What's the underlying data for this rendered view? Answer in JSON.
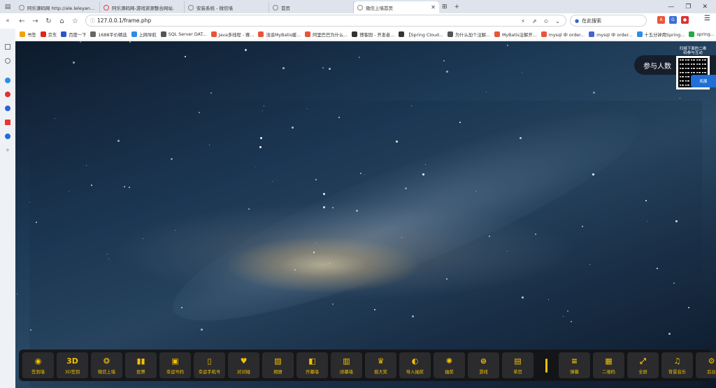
{
  "tabs": [
    {
      "label": "阿乐源码网 http://ale.leleyangyo",
      "active": false
    },
    {
      "label": "阿乐源码网-游戏资源整合网站.",
      "active": false
    },
    {
      "label": "安装系统 - 微信墙",
      "active": false
    },
    {
      "label": "首页",
      "active": false
    },
    {
      "label": "微信上墙首页",
      "active": true
    }
  ],
  "address": {
    "url": "127.0.0.1/frame.php"
  },
  "search": {
    "placeholder": "在此搜索"
  },
  "bookmarks": [
    {
      "label": "书签",
      "color": "#f2a20a"
    },
    {
      "label": "京东",
      "color": "#e1251b"
    },
    {
      "label": "百度一下",
      "color": "#2d56c9"
    },
    {
      "label": "1688平价精选",
      "color": "#666666"
    },
    {
      "label": "上网导航",
      "color": "#2a8de8"
    },
    {
      "label": "SQL Server DAT...",
      "color": "#555555"
    },
    {
      "label": "Java多线程 - 赛...",
      "color": "#e8553b"
    },
    {
      "label": "浅谈MyBatis缓...",
      "color": "#e8553b"
    },
    {
      "label": "阿里巴巴为什么...",
      "color": "#e8553b"
    },
    {
      "label": "博客园 - 开发者...",
      "color": "#333333"
    },
    {
      "label": "【Spring Cloud...",
      "color": "#333333"
    },
    {
      "label": "为什么加个注解...",
      "color": "#555555"
    },
    {
      "label": "MyBatis注解开...",
      "color": "#e8553b"
    },
    {
      "label": "mysql 中 order...",
      "color": "#e8553b"
    },
    {
      "label": "mysql 中 order...",
      "color": "#4466cc"
    },
    {
      "label": "十五分钟用Spring...",
      "color": "#2a8de8"
    },
    {
      "label": "spring...",
      "color": "#22aa44"
    }
  ],
  "participants": {
    "label": "参与人数"
  },
  "qr": {
    "caption1": "扫描下面的二维",
    "caption2": "码参与互动"
  },
  "side_badge": {
    "label": "拓展"
  },
  "toolbar": [
    {
      "label": "签到墙",
      "icon": "pin-icon"
    },
    {
      "label": "3D签到",
      "icon": "3d-icon"
    },
    {
      "label": "微信上墙",
      "icon": "wechat-icon"
    },
    {
      "label": "投票",
      "icon": "chart-icon"
    },
    {
      "label": "幸运号码",
      "icon": "ticket-icon"
    },
    {
      "label": "幸运手机号",
      "icon": "phone-icon"
    },
    {
      "label": "对对碰",
      "icon": "heart-icon"
    },
    {
      "label": "相册",
      "icon": "image-icon"
    },
    {
      "label": "开幕墙",
      "icon": "curtain-open-icon"
    },
    {
      "label": "闭幕墙",
      "icon": "curtain-close-icon"
    },
    {
      "label": "摇大奖",
      "icon": "trophy-icon"
    },
    {
      "label": "导入抽奖",
      "icon": "import-icon"
    },
    {
      "label": "抽奖",
      "icon": "wheel-icon"
    },
    {
      "label": "游戏",
      "icon": "gamepad-icon"
    },
    {
      "label": "单页",
      "icon": "page-icon"
    },
    {
      "label": "",
      "icon": "divider"
    },
    {
      "label": "弹幕",
      "icon": "danmaku-icon"
    },
    {
      "label": "二维码",
      "icon": "qrcode-icon"
    },
    {
      "label": "全屏",
      "icon": "fullscreen-icon"
    },
    {
      "label": "背景音乐",
      "icon": "music-icon"
    },
    {
      "label": "后台",
      "icon": "gear-icon"
    }
  ]
}
